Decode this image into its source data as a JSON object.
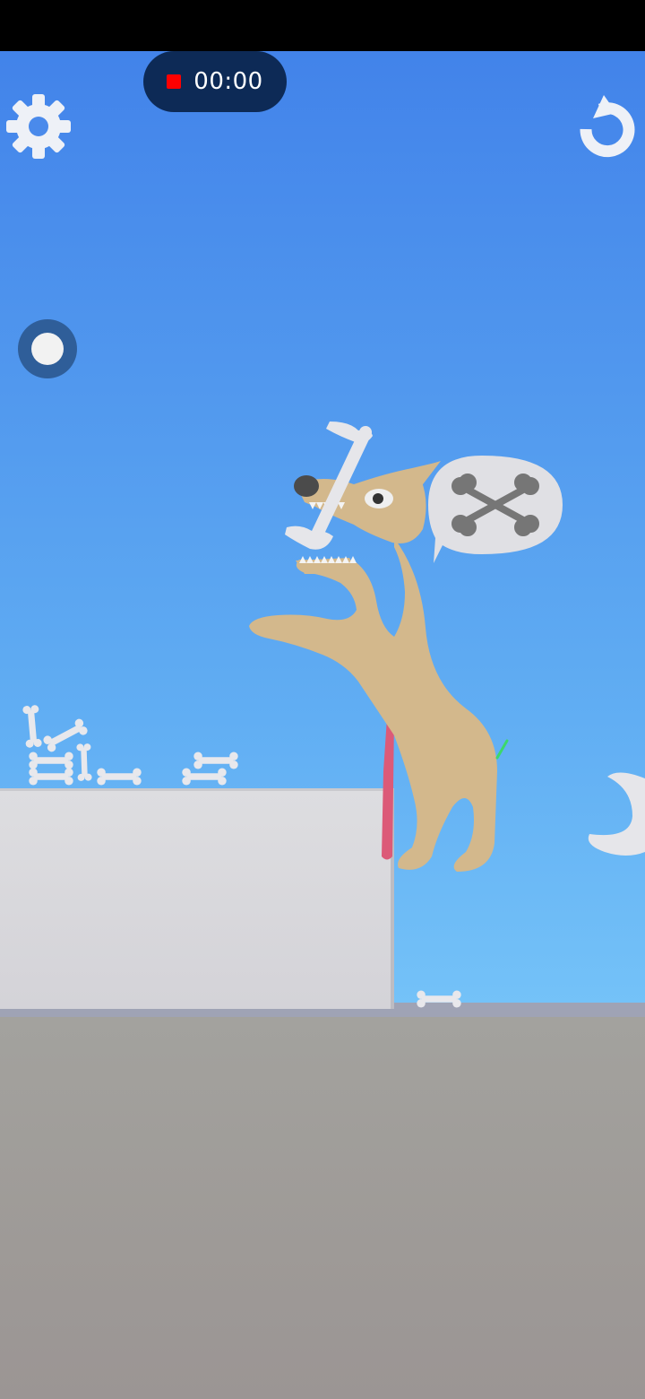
{
  "recording": {
    "timer": "00:00"
  },
  "hud": {
    "settings_icon": "gear-icon",
    "restart_icon": "restart-arrow-icon",
    "toggle_icon": "toggle-dot-icon"
  },
  "scene": {
    "speech_bubble_icon": "crossed-bones-icon",
    "colors": {
      "sky_top": "#4283ea",
      "sky_bottom": "#74c2f8",
      "dog": "#d3b88c",
      "bone": "#e6e6ea",
      "ledge": "#d6d5da",
      "ground": "#a09c99",
      "tongue": "#dc5a78",
      "timer_bg": "#0d2a56",
      "record": "#ff0000"
    }
  }
}
